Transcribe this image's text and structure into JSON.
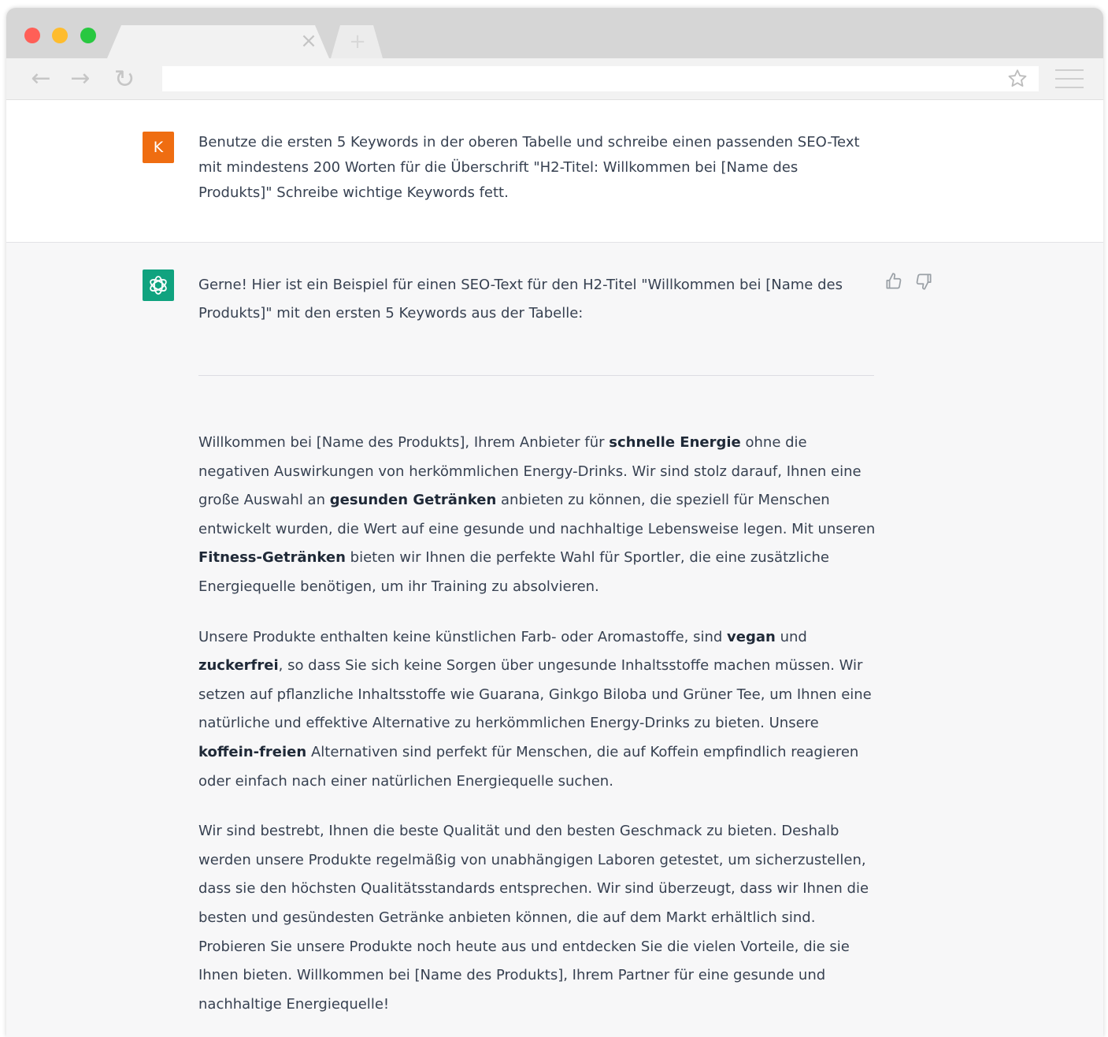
{
  "browser": {
    "tab_close_glyph": "×",
    "new_tab_glyph": "+",
    "back_glyph": "←",
    "forward_glyph": "→",
    "reload_glyph": "↻",
    "url": "",
    "icons": [
      "back-icon",
      "forward-icon",
      "reload-icon",
      "star-icon",
      "menu-icon",
      "close-icon",
      "plus-icon"
    ]
  },
  "user_message": {
    "avatar_letter": "K",
    "avatar_color": "#ef6d11",
    "text": "Benutze die ersten 5 Keywords in der oberen Tabelle und schreibe einen passenden SEO-Text mit mindestens 200 Worten für die Überschrift \"H2-Titel: Willkommen bei [Name des Produkts]\" Schreibe wichtige Keywords fett."
  },
  "assistant_message": {
    "avatar_color": "#10a37f",
    "intro": "Gerne! Hier ist ein Beispiel für einen SEO-Text für den H2-Titel \"Willkommen bei [Name des Produkts]\" mit den ersten 5 Keywords aus der Tabelle:",
    "p1": {
      "t1": "Willkommen bei [Name des Produkts], Ihrem Anbieter für ",
      "b1": "schnelle Energie",
      "t2": " ohne die negativen Auswirkungen von herkömmlichen Energy-Drinks. Wir sind stolz darauf, Ihnen eine große Auswahl an ",
      "b2": "gesunden Getränken",
      "t3": " anbieten zu können, die speziell für Menschen entwickelt wurden, die Wert auf eine gesunde und nachhaltige Lebensweise legen. Mit unseren ",
      "b3": "Fitness-Getränken",
      "t4": " bieten wir Ihnen die perfekte Wahl für Sportler, die eine zusätzliche Energiequelle benötigen, um ihr Training zu absolvieren."
    },
    "p2": {
      "t1": "Unsere Produkte enthalten keine künstlichen Farb- oder Aromastoffe, sind ",
      "b1": "vegan",
      "t2": " und ",
      "b2": "zuckerfrei",
      "t3": ", so dass Sie sich keine Sorgen über ungesunde Inhaltsstoffe machen müssen. Wir setzen auf pflanzliche Inhaltsstoffe wie Guarana, Ginkgo Biloba und Grüner Tee, um Ihnen eine natürliche und effektive Alternative zu herkömmlichen Energy-Drinks zu bieten. Unsere ",
      "b3": "koffein-freien",
      "t4": " Alternativen sind perfekt für Menschen, die auf Koffein empfindlich reagieren oder einfach nach einer natürlichen Energiequelle suchen."
    },
    "p3": "Wir sind bestrebt, Ihnen die beste Qualität und den besten Geschmack zu bieten. Deshalb werden unsere Produkte regelmäßig von unabhängigen Laboren getestet, um sicherzustellen, dass sie den höchsten Qualitätsstandards entsprechen. Wir sind überzeugt, dass wir Ihnen die besten und gesündesten Getränke anbieten können, die auf dem Markt erhältlich sind. Probieren Sie unsere Produkte noch heute aus und entdecken Sie die vielen Vorteile, die sie Ihnen bieten. Willkommen bei [Name des Produkts], Ihrem Partner für eine gesunde und nachhaltige Energiequelle!",
    "icons": [
      "thumbs-up-icon",
      "thumbs-down-icon",
      "openai-logo-icon"
    ]
  }
}
